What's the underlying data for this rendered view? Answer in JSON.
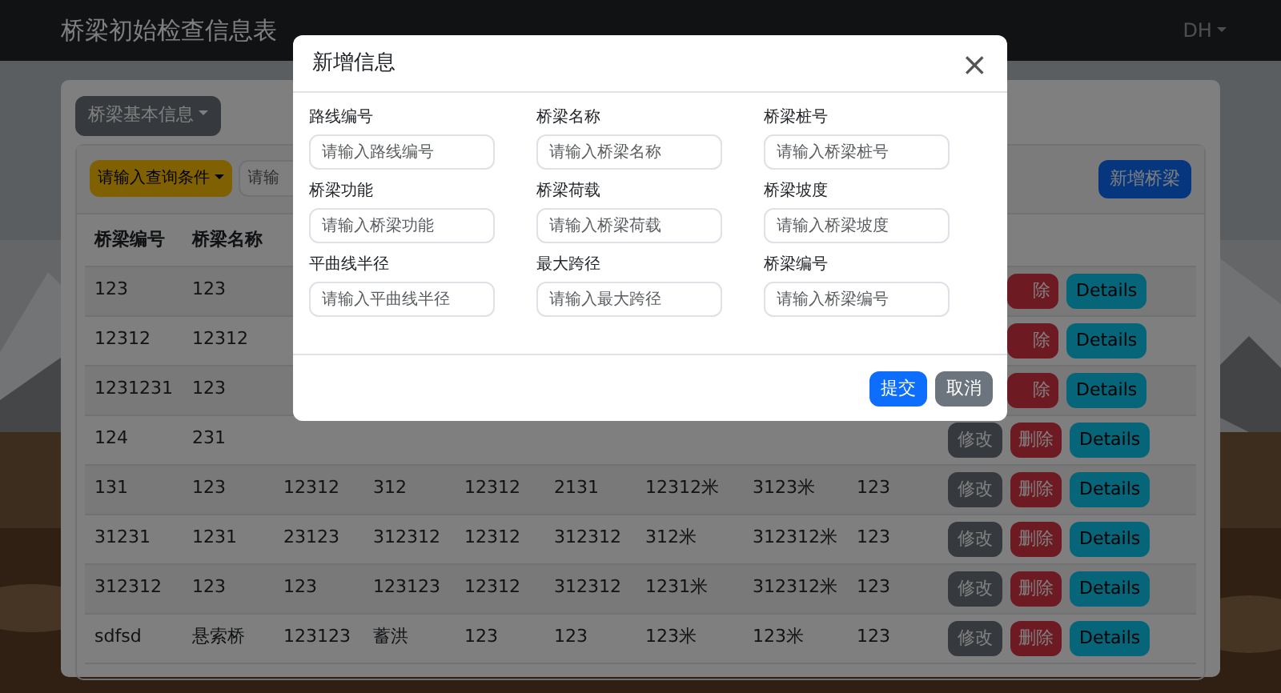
{
  "navbar": {
    "brand": "桥梁初始检查信息表",
    "user": "DH"
  },
  "section_button": "桥梁基本信息",
  "search": {
    "condition_button": "请输入查询条件",
    "placeholder": "请输"
  },
  "add_button": "新增桥梁",
  "table": {
    "columns": [
      "桥梁编号",
      "桥梁名称"
    ],
    "rows": [
      {
        "cells": [
          "123",
          "123"
        ],
        "actions": {
          "delete": "除",
          "details": "Details"
        }
      },
      {
        "cells": [
          "12312",
          "12312"
        ],
        "actions": {
          "delete": "除",
          "details": "Details"
        }
      },
      {
        "cells": [
          "1231231",
          "123"
        ],
        "actions": {
          "delete": "除",
          "details": "Details"
        }
      },
      {
        "cells": [
          "124",
          "231"
        ],
        "actions": {
          "edit": "修改",
          "delete": "删除",
          "details": "Details"
        }
      },
      {
        "cells": [
          "131",
          "123",
          "12312",
          "312",
          "12312",
          "2131",
          "12312米",
          "3123米",
          "123"
        ],
        "actions": {
          "edit": "修改",
          "delete": "删除",
          "details": "Details"
        }
      },
      {
        "cells": [
          "31231",
          "1231",
          "23123",
          "312312",
          "12312",
          "312312",
          "312米",
          "312312米",
          "123"
        ],
        "actions": {
          "edit": "修改",
          "delete": "删除",
          "details": "Details"
        }
      },
      {
        "cells": [
          "312312",
          "123",
          "123",
          "123123",
          "12312",
          "312312",
          "1231米",
          "312312米",
          "123"
        ],
        "actions": {
          "edit": "修改",
          "delete": "删除",
          "details": "Details"
        }
      },
      {
        "cells": [
          "sdfsd",
          "悬索桥",
          "123123",
          "蓄洪",
          "123",
          "123",
          "123米",
          "123米",
          "123"
        ],
        "actions": {
          "edit": "修改",
          "delete": "删除",
          "details": "Details"
        }
      }
    ]
  },
  "modal": {
    "title": "新增信息",
    "close": "×",
    "fields": [
      {
        "label": "路线编号",
        "placeholder": "请输入路线编号"
      },
      {
        "label": "桥梁名称",
        "placeholder": "请输入桥梁名称"
      },
      {
        "label": "桥梁桩号",
        "placeholder": "请输入桥梁桩号"
      },
      {
        "label": "桥梁功能",
        "placeholder": "请输入桥梁功能"
      },
      {
        "label": "桥梁荷载",
        "placeholder": "请输入桥梁荷载"
      },
      {
        "label": "桥梁坡度",
        "placeholder": "请输入桥梁坡度"
      },
      {
        "label": "平曲线半径",
        "placeholder": "请输入平曲线半径"
      },
      {
        "label": "最大跨径",
        "placeholder": "请输入最大跨径"
      },
      {
        "label": "桥梁编号",
        "placeholder": "请输入桥梁编号"
      }
    ],
    "buttons": [
      {
        "label": "提交",
        "kind": "primary"
      },
      {
        "label": "取消",
        "kind": "secondary"
      }
    ]
  }
}
